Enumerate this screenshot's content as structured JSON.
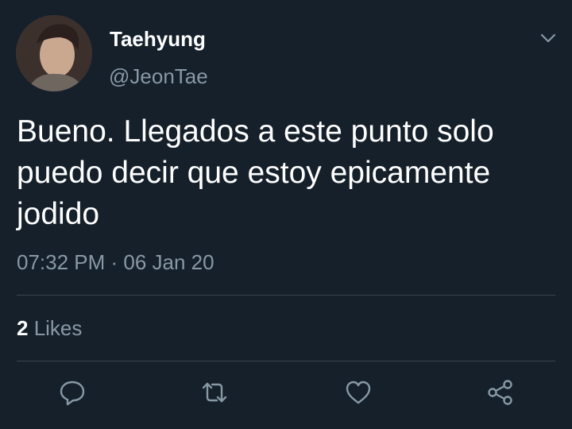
{
  "tweet": {
    "author": {
      "display_name": "Taehyung",
      "handle": "@JeonTae"
    },
    "text": "Bueno. Llegados a este punto solo puedo decir que estoy epicamente jodido",
    "timestamp": "07:32 PM · 06 Jan 20",
    "likes": {
      "count": "2",
      "label": " Likes"
    }
  },
  "icons": {
    "menu": "chevron-down-icon",
    "reply": "reply-icon",
    "retweet": "retweet-icon",
    "like": "heart-icon",
    "share": "share-icon"
  },
  "colors": {
    "background": "#15202b",
    "primary_text": "#ffffff",
    "secondary_text": "#8899a6",
    "divider": "#38444d"
  }
}
